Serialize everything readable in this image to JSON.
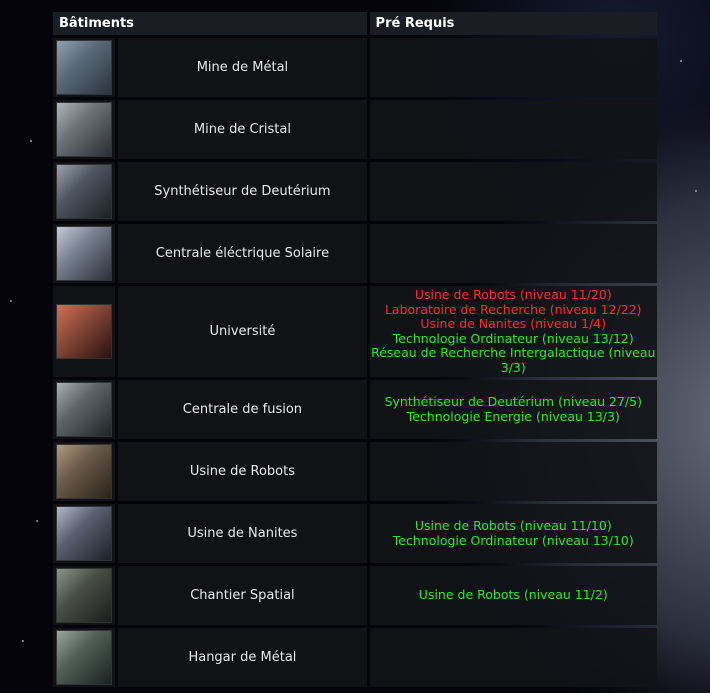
{
  "header": {
    "col_buildings": "Bâtiments",
    "col_requirements": "Pré Requis"
  },
  "colors": {
    "met": "#22ee22",
    "unmet": "#ff2a2a"
  },
  "rows": [
    {
      "name": "Mine de Métal",
      "image": "metal-mine-image",
      "requirements": []
    },
    {
      "name": "Mine de Cristal",
      "image": "crystal-mine-image",
      "requirements": []
    },
    {
      "name": "Synthétiseur de Deutérium",
      "image": "deuterium-synthesizer-image",
      "requirements": []
    },
    {
      "name": "Centrale éléctrique Solaire",
      "image": "solar-plant-image",
      "requirements": []
    },
    {
      "name": "Université",
      "image": "university-image",
      "requirements": [
        {
          "text": "Usine de Robots (niveau 11/20)",
          "met": false
        },
        {
          "text": "Laboratoire de Recherche (niveau 12/22)",
          "met": false
        },
        {
          "text": "Usine de Nanites (niveau 1/4)",
          "met": false
        },
        {
          "text": "Technologie Ordinateur (niveau 13/12)",
          "met": true
        },
        {
          "text": "Réseau de Recherche Intergalactique (niveau 3/3)",
          "met": true
        }
      ]
    },
    {
      "name": "Centrale de fusion",
      "image": "fusion-plant-image",
      "requirements": [
        {
          "text": "Synthétiseur de Deutérium (niveau 27/5)",
          "met": true
        },
        {
          "text": "Technologie Energie (niveau 13/3)",
          "met": true
        }
      ]
    },
    {
      "name": "Usine de Robots",
      "image": "robot-factory-image",
      "requirements": []
    },
    {
      "name": "Usine de Nanites",
      "image": "nanite-factory-image",
      "requirements": [
        {
          "text": "Usine de Robots (niveau 11/10)",
          "met": true
        },
        {
          "text": "Technologie Ordinateur (niveau 13/10)",
          "met": true
        }
      ]
    },
    {
      "name": "Chantier Spatial",
      "image": "shipyard-image",
      "requirements": [
        {
          "text": "Usine de Robots (niveau 11/2)",
          "met": true
        }
      ]
    },
    {
      "name": "Hangar de Métal",
      "image": "metal-storage-image",
      "requirements": []
    }
  ]
}
